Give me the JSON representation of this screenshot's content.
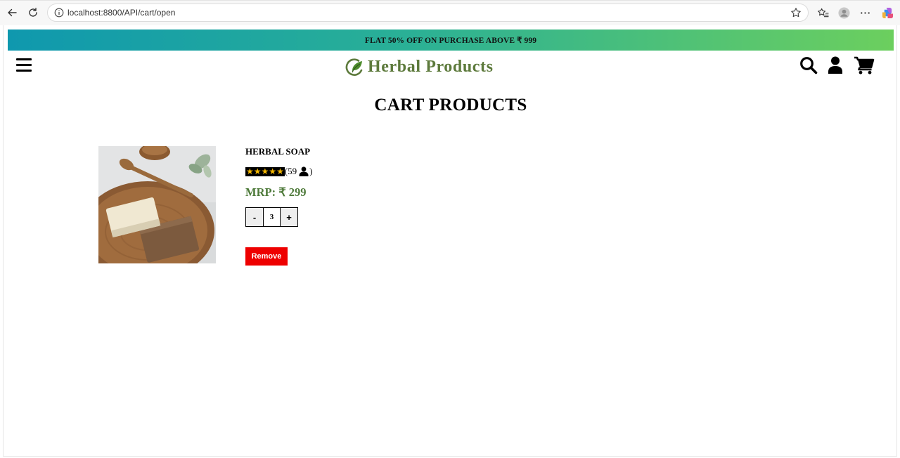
{
  "browser": {
    "url": "localhost:8800/API/cart/open"
  },
  "banner": {
    "text": "FLAT 50% OFF ON PURCHASE ABOVE ₹ 999"
  },
  "header": {
    "logo_text": "Herbal Products",
    "icons": [
      "menu-icon",
      "search-icon",
      "user-icon",
      "cart-icon"
    ],
    "brand_color": "#5d7a3c"
  },
  "page": {
    "title": "CART PRODUCTS"
  },
  "cart": {
    "items": [
      {
        "name": "HERBAL SOAP",
        "rating_stars": 5,
        "reviews_text": "(59",
        "reviews_suffix": ")",
        "price": "MRP: ₹ 299",
        "quantity": "3",
        "decrement_label": "-",
        "increment_label": "+",
        "remove_label": "Remove"
      }
    ]
  },
  "colors": {
    "banner_gradient": [
      "#0f98ae",
      "#6ccf5e"
    ],
    "price": "#4e7a3a",
    "remove_button": "#ee0000"
  }
}
